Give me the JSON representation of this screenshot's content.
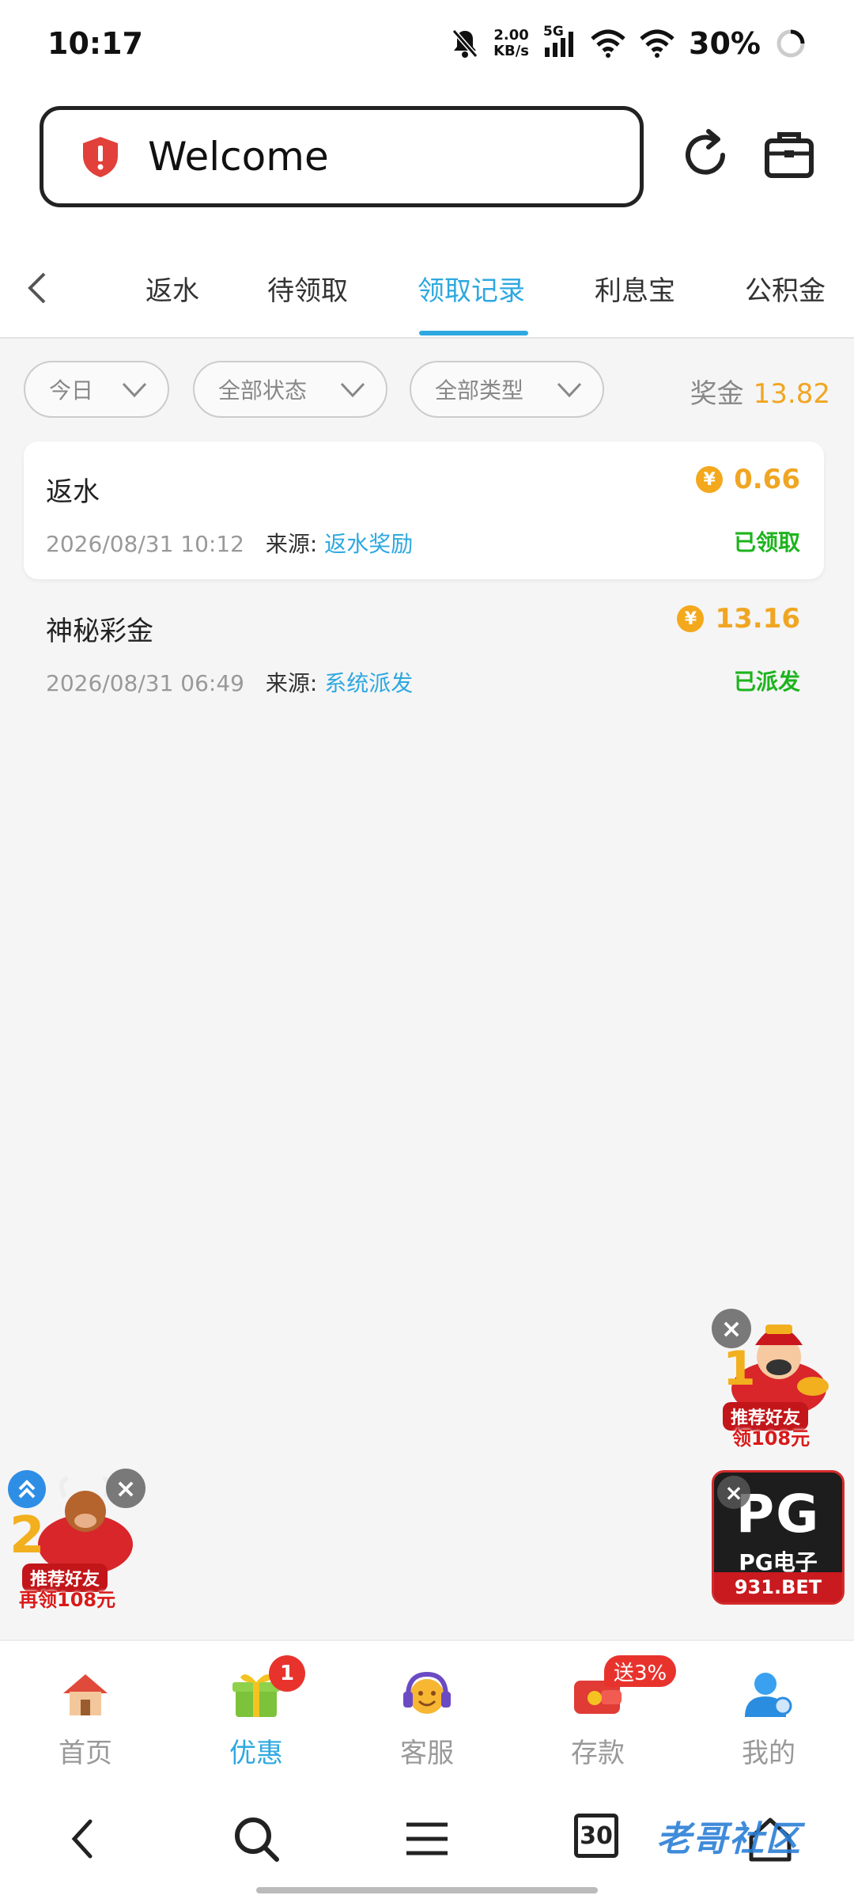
{
  "status_bar": {
    "time": "10:17",
    "net_speed_value": "2.00",
    "net_speed_unit": "KB/s",
    "network": "5G",
    "battery": "30%",
    "icons": [
      "bell-off-icon",
      "signal-icon",
      "wifi-icon",
      "wifi-icon",
      "loading-icon"
    ]
  },
  "address_bar": {
    "text": "Welcome",
    "icons": [
      "shield-alert-icon",
      "reload-icon",
      "briefcase-icon"
    ]
  },
  "tabs": [
    {
      "label": "返水"
    },
    {
      "label": "待领取"
    },
    {
      "label": "领取记录",
      "active": true
    },
    {
      "label": "利息宝"
    },
    {
      "label": "公积金"
    }
  ],
  "filters": {
    "date": "今日",
    "status": "全部状态",
    "type": "全部类型",
    "bonus_label": "奖金",
    "bonus_value": "13.82"
  },
  "records": [
    {
      "title": "返水",
      "amount": "0.66",
      "datetime": "2026/08/31 10:12",
      "source_label": "来源:",
      "source": "返水奖励",
      "status": "已领取"
    },
    {
      "title": "神秘彩金",
      "amount": "13.16",
      "datetime": "2026/08/31 06:49",
      "source_label": "来源:",
      "source": "系统派发",
      "status": "已派发"
    }
  ],
  "coin_symbol": "¥",
  "promos": {
    "left": {
      "caption": "推荐好友",
      "caption2": "再领108元"
    },
    "right_top": {
      "caption": "推荐好友",
      "caption2": "领108元"
    },
    "pg": {
      "logo": "PG",
      "title": "PG电子",
      "site": "931.BET"
    }
  },
  "bottom_nav": [
    {
      "label": "首页",
      "icon": "home-icon"
    },
    {
      "label": "优惠",
      "icon": "gift-icon",
      "badge": "1",
      "active": true
    },
    {
      "label": "客服",
      "icon": "headset-icon"
    },
    {
      "label": "存款",
      "icon": "wallet-icon",
      "badge": "送3%"
    },
    {
      "label": "我的",
      "icon": "user-icon"
    }
  ],
  "browser_bar": {
    "tab_count": "30",
    "watermark": "老哥社区"
  },
  "colors": {
    "accent": "#2ea8e0",
    "gold": "#f0a623",
    "success": "#1db41d",
    "badge": "#e8332d"
  }
}
